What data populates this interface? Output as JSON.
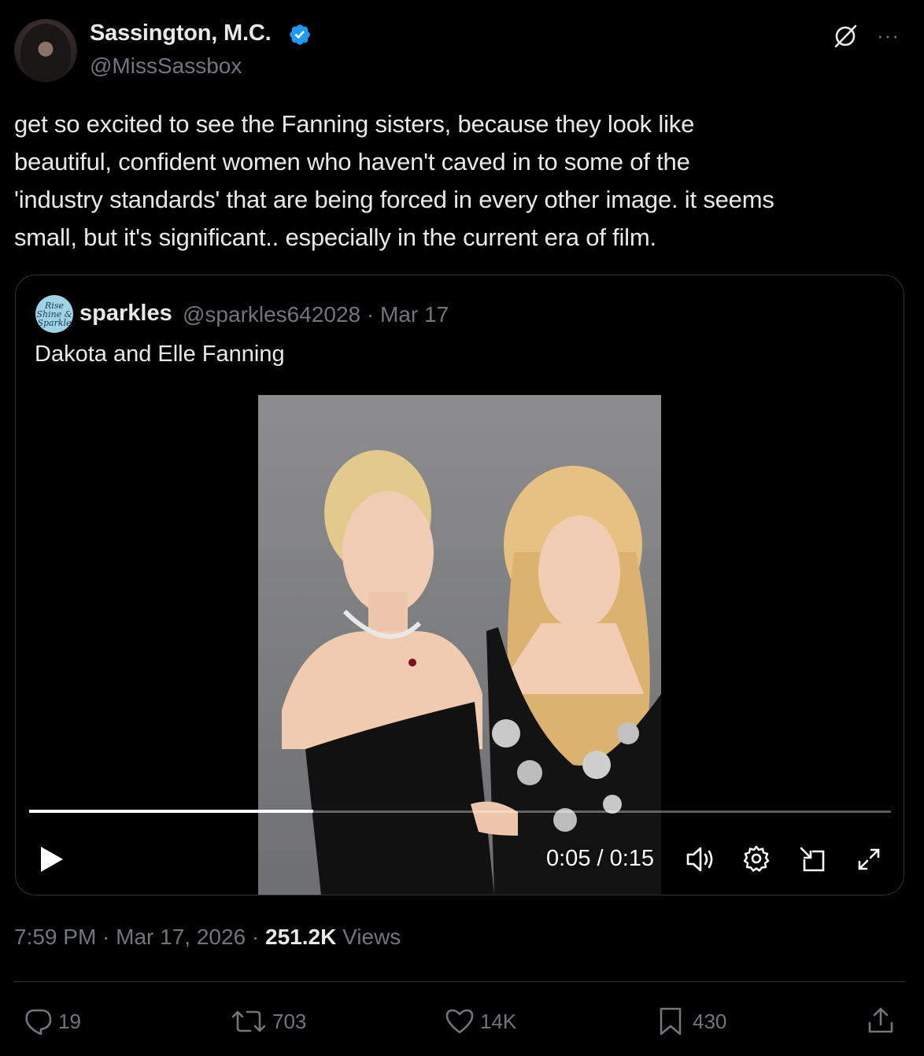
{
  "author": {
    "display_name": "Sassington, M.C.",
    "handle": "@MissSassbox",
    "verified": true
  },
  "header_icons": [
    "grok-icon",
    "more-icon"
  ],
  "more_label": "···",
  "tweet": {
    "text": "get so excited to see the Fanning sisters, because they look like\nbeautiful, confident women who haven't caved in to some of the\n'industry standards' that are being forced in every other image. it seems\nsmall, but it's significant.. especially in the current era of film."
  },
  "quote": {
    "avatar_text": "Rise Shine & Sparkle",
    "name": "sparkles",
    "handle_date": "@sparkles642028 · Mar 17",
    "text": "Dakota and Elle Fanning",
    "video": {
      "time": "0:05 / 0:15",
      "progress": 0.33
    }
  },
  "meta": {
    "time_date": "7:59 PM · Mar 17, 2026 · ",
    "views_count": "251.2K",
    "views_label": " Views"
  },
  "actions": {
    "replies": "19",
    "reposts": "703",
    "likes": "14K",
    "bookmarks": "430"
  },
  "colors": {
    "background": "#000000",
    "text": "#e7e9ea",
    "secondary": "#71767b",
    "border": "#2f3336",
    "verified": "#1d9bf0"
  }
}
